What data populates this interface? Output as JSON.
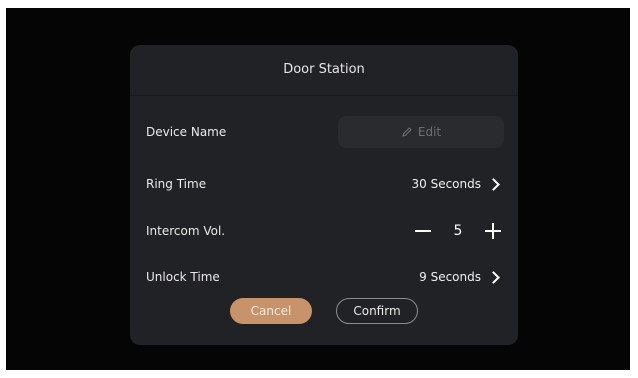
{
  "dialog": {
    "title": "Door Station",
    "device_name": {
      "label": "Device Name",
      "edit_label": "Edit"
    },
    "ring_time": {
      "label": "Ring Time",
      "value": "30 Seconds"
    },
    "intercom_volume": {
      "label": "Intercom Vol.",
      "value": "5"
    },
    "unlock_time": {
      "label": "Unlock Time",
      "value": "9 Seconds"
    },
    "cancel_label": "Cancel",
    "confirm_label": "Confirm"
  },
  "colors": {
    "accent": "#c8926a",
    "dialog_bg": "#212225",
    "screen_bg": "#050505"
  }
}
